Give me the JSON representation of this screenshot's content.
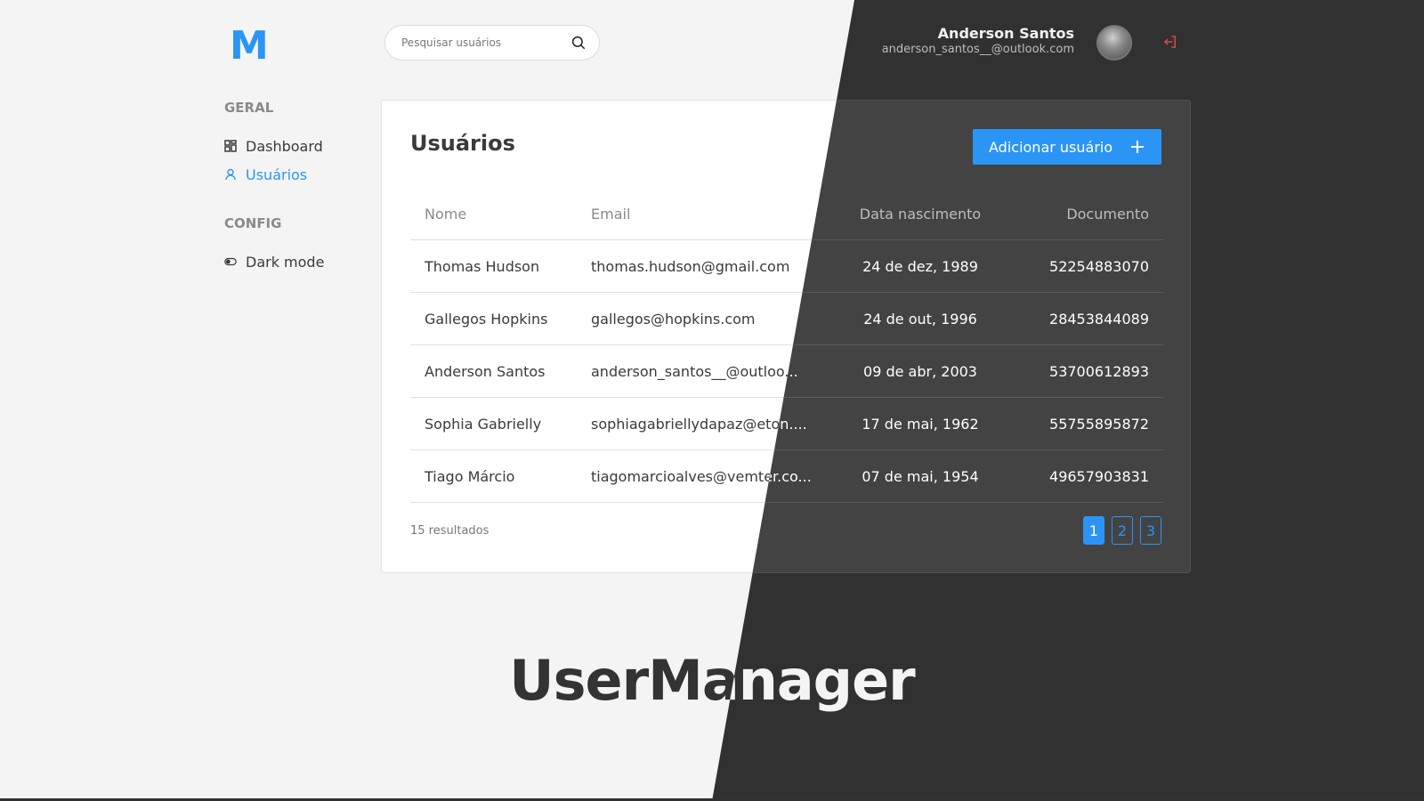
{
  "logo": "M",
  "search": {
    "placeholder": "Pesquisar usuários"
  },
  "user": {
    "name": "Anderson Santos",
    "email": "anderson_santos__@outlook.com"
  },
  "sidebar": {
    "sections": [
      {
        "heading": "GERAL",
        "items": [
          {
            "label": "Dashboard",
            "icon": "grid-icon"
          },
          {
            "label": "Usuários",
            "icon": "user-icon",
            "active": true
          }
        ]
      },
      {
        "heading": "CONFIG",
        "items": [
          {
            "label": "Dark mode",
            "icon": "toggle-icon"
          }
        ]
      }
    ]
  },
  "main": {
    "title": "Usuários",
    "add_button": "Adicionar usuário",
    "table": {
      "headers": [
        "Nome",
        "Email",
        "Data nascimento",
        "Documento"
      ],
      "rows": [
        [
          "Thomas Hudson",
          "thomas.hudson@gmail.com",
          "24 de dez, 1989",
          "52254883070"
        ],
        [
          "Gallegos Hopkins",
          "gallegos@hopkins.com",
          "24 de out, 1996",
          "28453844089"
        ],
        [
          "Anderson Santos",
          "anderson_santos__@outloo...",
          "09 de abr, 2003",
          "53700612893"
        ],
        [
          "Sophia Gabrielly",
          "sophiagabriellydapaz@eton....",
          "17 de mai, 1962",
          "55755895872"
        ],
        [
          "Tiago Márcio",
          "tiagomarcioalves@vemter.co...",
          "07 de mai, 1954",
          "49657903831"
        ]
      ]
    },
    "results": "15 resultados",
    "pages": [
      "1",
      "2",
      "3"
    ],
    "current_page": "1"
  },
  "brand": "UserManager",
  "colors": {
    "accent": "#2b95f5",
    "light_bg": "#f4f4f4",
    "dark_bg": "#313131",
    "logout": "#e04848"
  }
}
